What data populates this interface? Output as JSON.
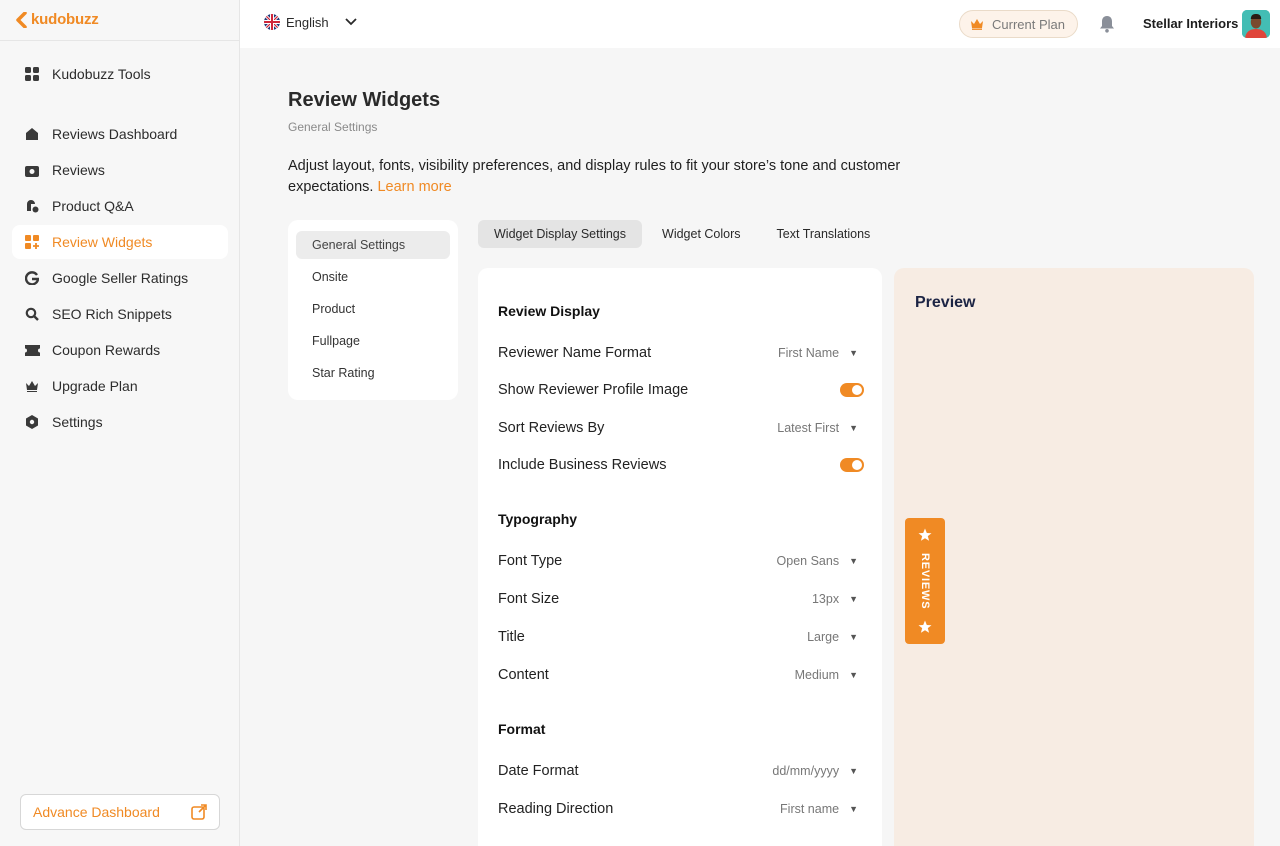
{
  "brand": {
    "name": "kudobuzz",
    "accent": "#f08a24"
  },
  "sidebar": {
    "items": [
      {
        "label": "Kudobuzz Tools",
        "icon": "grid-icon"
      },
      {
        "label": "Reviews Dashboard",
        "icon": "home-icon"
      },
      {
        "label": "Reviews",
        "icon": "camera-icon"
      },
      {
        "label": "Product Q&A",
        "icon": "qa-icon"
      },
      {
        "label": "Review Widgets",
        "icon": "widgets-icon",
        "active": true
      },
      {
        "label": "Google Seller Ratings",
        "icon": "google-icon"
      },
      {
        "label": "SEO Rich Snippets",
        "icon": "seo-icon"
      },
      {
        "label": "Coupon Rewards",
        "icon": "coupon-icon"
      },
      {
        "label": "Upgrade Plan",
        "icon": "crown-icon"
      },
      {
        "label": "Settings",
        "icon": "settings-icon"
      }
    ],
    "advance_dashboard": "Advance Dashboard"
  },
  "topbar": {
    "language": "English",
    "current_plan": "Current Plan",
    "user_name": "Stellar Interiors"
  },
  "page": {
    "title": "Review Widgets",
    "subtitle": "General Settings",
    "description": "Adjust layout, fonts, visibility preferences, and display rules to fit your store’s tone and customer expectations.",
    "learn_more": "Learn more"
  },
  "subnav": [
    "General Settings",
    "Onsite",
    "Product",
    "Fullpage",
    "Star Rating"
  ],
  "tabs": [
    "Widget Display Settings",
    "Widget Colors",
    "Text Translations"
  ],
  "settings": {
    "review_display": {
      "title": "Review Display",
      "reviewer_name_format": {
        "label": "Reviewer Name Format",
        "value": "First Name"
      },
      "show_profile_image": {
        "label": "Show Reviewer Profile Image",
        "on": true
      },
      "sort_reviews": {
        "label": "Sort Reviews By",
        "value": "Latest First"
      },
      "include_business": {
        "label": "Include Business Reviews",
        "on": true
      }
    },
    "typography": {
      "title": "Typography",
      "font_type": {
        "label": "Font Type",
        "value": "Open Sans"
      },
      "font_size": {
        "label": "Font Size",
        "value": "13px"
      },
      "title_size": {
        "label": "Title",
        "value": "Large"
      },
      "content_size": {
        "label": "Content",
        "value": "Medium"
      }
    },
    "format": {
      "title": "Format",
      "date_format": {
        "label": "Date Format",
        "value": "dd/mm/yyyy"
      },
      "reading_direction": {
        "label": "Reading Direction",
        "value": "First name"
      }
    }
  },
  "preview": {
    "title": "Preview",
    "reviews_tab": "REVIEWS"
  }
}
